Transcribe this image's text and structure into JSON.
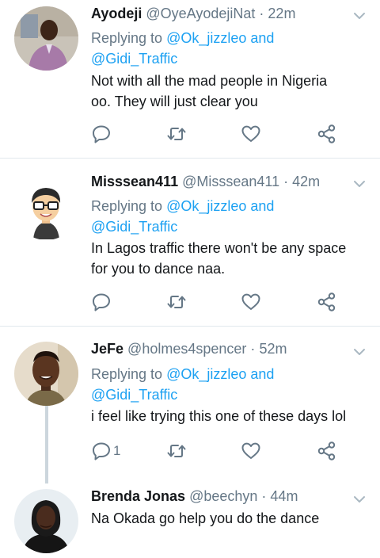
{
  "tweets": [
    {
      "name": "Ayodeji",
      "handle": "@OyeAyodejiNat",
      "separator": "·",
      "time": "22m",
      "reply_prefix": "Replying to",
      "reply_mention_1": "@Ok_jizzleo",
      "reply_and": "and",
      "reply_mention_2": "@Gidi_Traffic",
      "text_line_1": "Not with all the mad people in Nigeria",
      "text_line_2": "oo. They will just clear you",
      "reply_count": ""
    },
    {
      "name": "Misssean411",
      "handle": "@Misssean411",
      "separator": "·",
      "time": "42m",
      "reply_prefix": "Replying to",
      "reply_mention_1": "@Ok_jizzleo",
      "reply_and": "and",
      "reply_mention_2": "@Gidi_Traffic",
      "text_line_1": "In Lagos traffic there won't be any space",
      "text_line_2": "for you to dance naa.",
      "reply_count": ""
    },
    {
      "name": "JeFe",
      "handle": "@holmes4spencer",
      "separator": "·",
      "time": "52m",
      "reply_prefix": "Replying to",
      "reply_mention_1": "@Ok_jizzleo",
      "reply_and": "and",
      "reply_mention_2": "@Gidi_Traffic",
      "text_line_1": "i feel like trying this one of these days lol",
      "text_line_2": "",
      "reply_count": "1"
    },
    {
      "name": "Brenda Jonas",
      "handle": "@beechyn",
      "separator": "·",
      "time": "44m",
      "text_line_1": "Na Okada go help you do the dance"
    }
  ],
  "icons": {
    "reply": "reply-icon",
    "retweet": "retweet-icon",
    "like": "heart-icon",
    "share": "share-icon",
    "more": "chevron-down-icon"
  },
  "colors": {
    "link": "#1da1f2",
    "secondary_text": "#657786",
    "icon": "#657786",
    "divider": "#e1e8ed",
    "thread_line": "#ccd6dd"
  }
}
